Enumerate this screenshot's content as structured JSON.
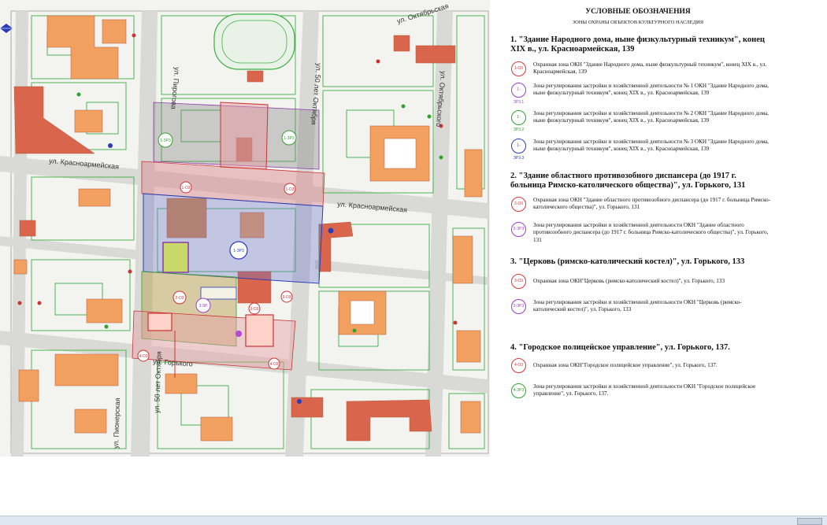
{
  "colors": {
    "protection_zone": "#d43a3a",
    "zone_1_reg1": "#a03cc8",
    "zone_1_reg2": "#2fa32f",
    "zone_1_reg3": "#2a3cb8",
    "zone_2_reg": "#a03cc8",
    "zone_3_reg": "#a03cc8",
    "zone_4_reg": "#2fa32f",
    "building_orange": "#f2a05f",
    "building_red": "#d9664c",
    "lot_green": "#35a835"
  },
  "map": {
    "streets": {
      "oktyabrskaya": "ул. Октябрьская",
      "krasnoarmeyskaya_left": "ул. Красноармейская",
      "krasnoarmeyskaya_right": "ул. Красноармейская",
      "gorkogo": "ул. Горького",
      "pirogova": "ул. Пирогова",
      "fifty_october_top": "ул. 50 лет Октября",
      "fifty_october_bottom": "ул. 50 лет Октября",
      "oktyabrskogo": "ул. Октябрьского",
      "pionerskaya": "ул. Пионерская"
    },
    "zone_labels": {
      "z1_reg3_a": "1-ЗР3",
      "z1_reg3_b": "1-ЗР3",
      "z1_reg3_c": "1-ЗР3",
      "z1_o": "1-О3",
      "z1_o_b": "1-О3",
      "z2_o": "2-О3",
      "z3_reg": "3-ЗР",
      "z3_o": "3-О3",
      "z4_o": "4-О3",
      "z4_o_b": "4-О3",
      "z3_o_b": "3-О3"
    }
  },
  "legend": {
    "title": "УСЛОВНЫЕ ОБОЗНАЧЕНИЯ",
    "subtitle": "ЗОНЫ ОХРАНЫ ОБЪЕКТОВ КУЛЬТУРНОГО НАСЛЕДИЯ",
    "sections": [
      {
        "title": "1. \"Здание Народного дома, ныне физкультурный техникум\", конец XIX в., ул. Красноармейская, 139",
        "items": [
          {
            "code": "1-О3",
            "color": "#d43a3a",
            "text": "Охранная зона ОКН \"Здание Народного дома, ныне физкультурный техникум\", конец XIX в., ул. Красноармейская, 139"
          },
          {
            "code": "1-ЗР3.1",
            "color": "#a03cc8",
            "text": "Зона регулирования застройки и хозяйственной деятельности № 1 ОКН \"Здание Народного дома, ныне физкультурный техникум\", конец XIX в., ул. Красноармейская, 139"
          },
          {
            "code": "1-ЗР3.2",
            "color": "#2fa32f",
            "text": "Зона регулирования застройки и хозяйственной деятельности № 2 ОКН \"Здание Народного дома, ныне физкультурный техникум\", конец XIX в., ул. Красноармейская, 139"
          },
          {
            "code": "1-ЗР3.3",
            "color": "#2a3cb8",
            "text": "Зона регулирования застройки и хозяйственной деятельности № 3 ОКН \"Здание Народного дома, ныне физкультурный техникум\", конец XIX в., ул. Красноармейская, 139"
          }
        ]
      },
      {
        "title": "2. \"Здание областного противозобного диспансера (до 1917 г. больница Римско-католического общества)\", ул. Горького, 131",
        "items": [
          {
            "code": "2-О3",
            "color": "#d43a3a",
            "text": "Охранная зона ОКН \"Здание областного противозобного диспансера (до 1917 г. больница Римско-католического общества)\", ул. Горького, 131"
          },
          {
            "code": "2-ЗР3",
            "color": "#a03cc8",
            "text": "Зона регулирования застройки и хозяйственной деятельности ОКН \"Здание областного противозобного диспансера (до 1917 г. больница Римско-католического общества)\", ул. Горького, 131"
          }
        ]
      },
      {
        "title": "3. \"Церковь (римско-католический костел)\", ул. Горького, 133",
        "items": [
          {
            "code": "3-О3",
            "color": "#d43a3a",
            "text": "Охранная зона ОКН\"Церковь (римско-католический костел)\", ул. Горького, 133"
          },
          {
            "code": "3-ЗР3",
            "color": "#a03cc8",
            "text": "Зона регулирования застройки и хозяйственной деятельности ОКН \"Церковь (римско-католический костел)\", ул. Горького, 133"
          }
        ]
      },
      {
        "title": "4. \"Городское полицейское управление\", ул. Горького, 137.",
        "items": [
          {
            "code": "4-О3",
            "color": "#d43a3a",
            "text": "Охранная зона ОКН\"Городское полицейское управление\", ул. Горького, 137."
          },
          {
            "code": "4-ЗР3",
            "color": "#2fa32f",
            "text": "Зона регулирования застройки и хозяйственной деятельности ОКН \"Городское полицейское управление\", ул. Горького, 137."
          }
        ]
      }
    ]
  }
}
